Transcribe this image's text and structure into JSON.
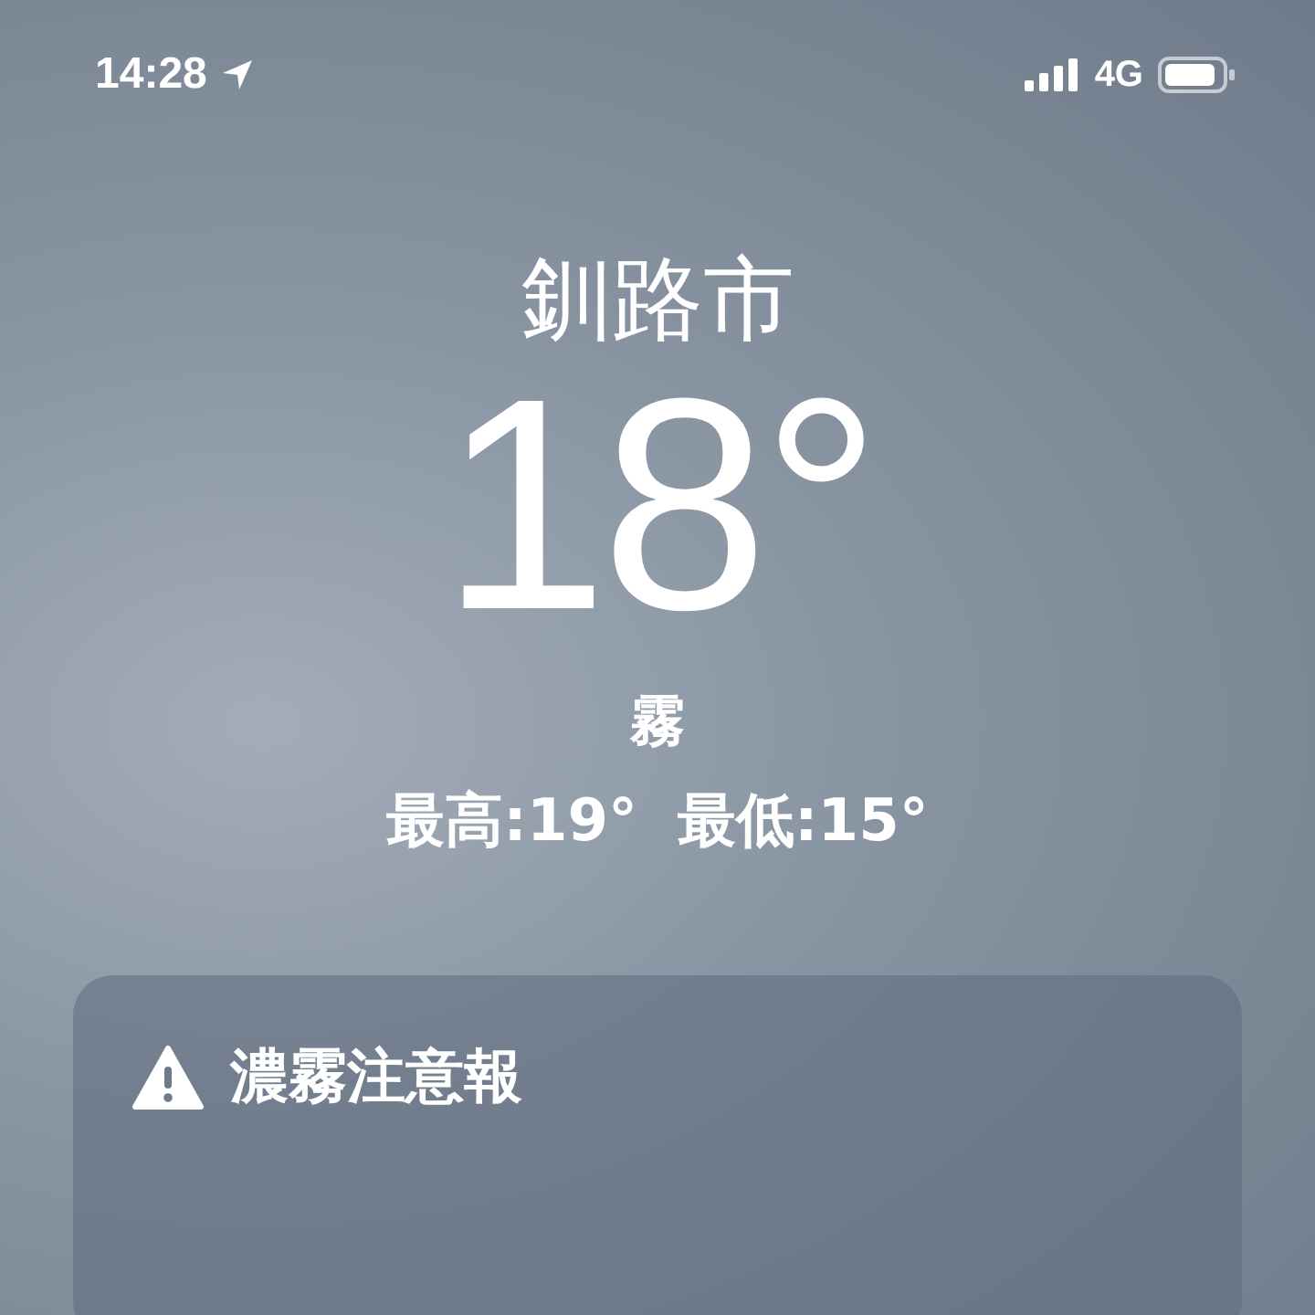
{
  "status_bar": {
    "time": "14:28",
    "network": "4G"
  },
  "weather": {
    "city": "釧路市",
    "temperature": "18°",
    "condition": "霧",
    "high": "最高:19°",
    "low": "最低:15°"
  },
  "alert": {
    "title": "濃霧注意報"
  }
}
